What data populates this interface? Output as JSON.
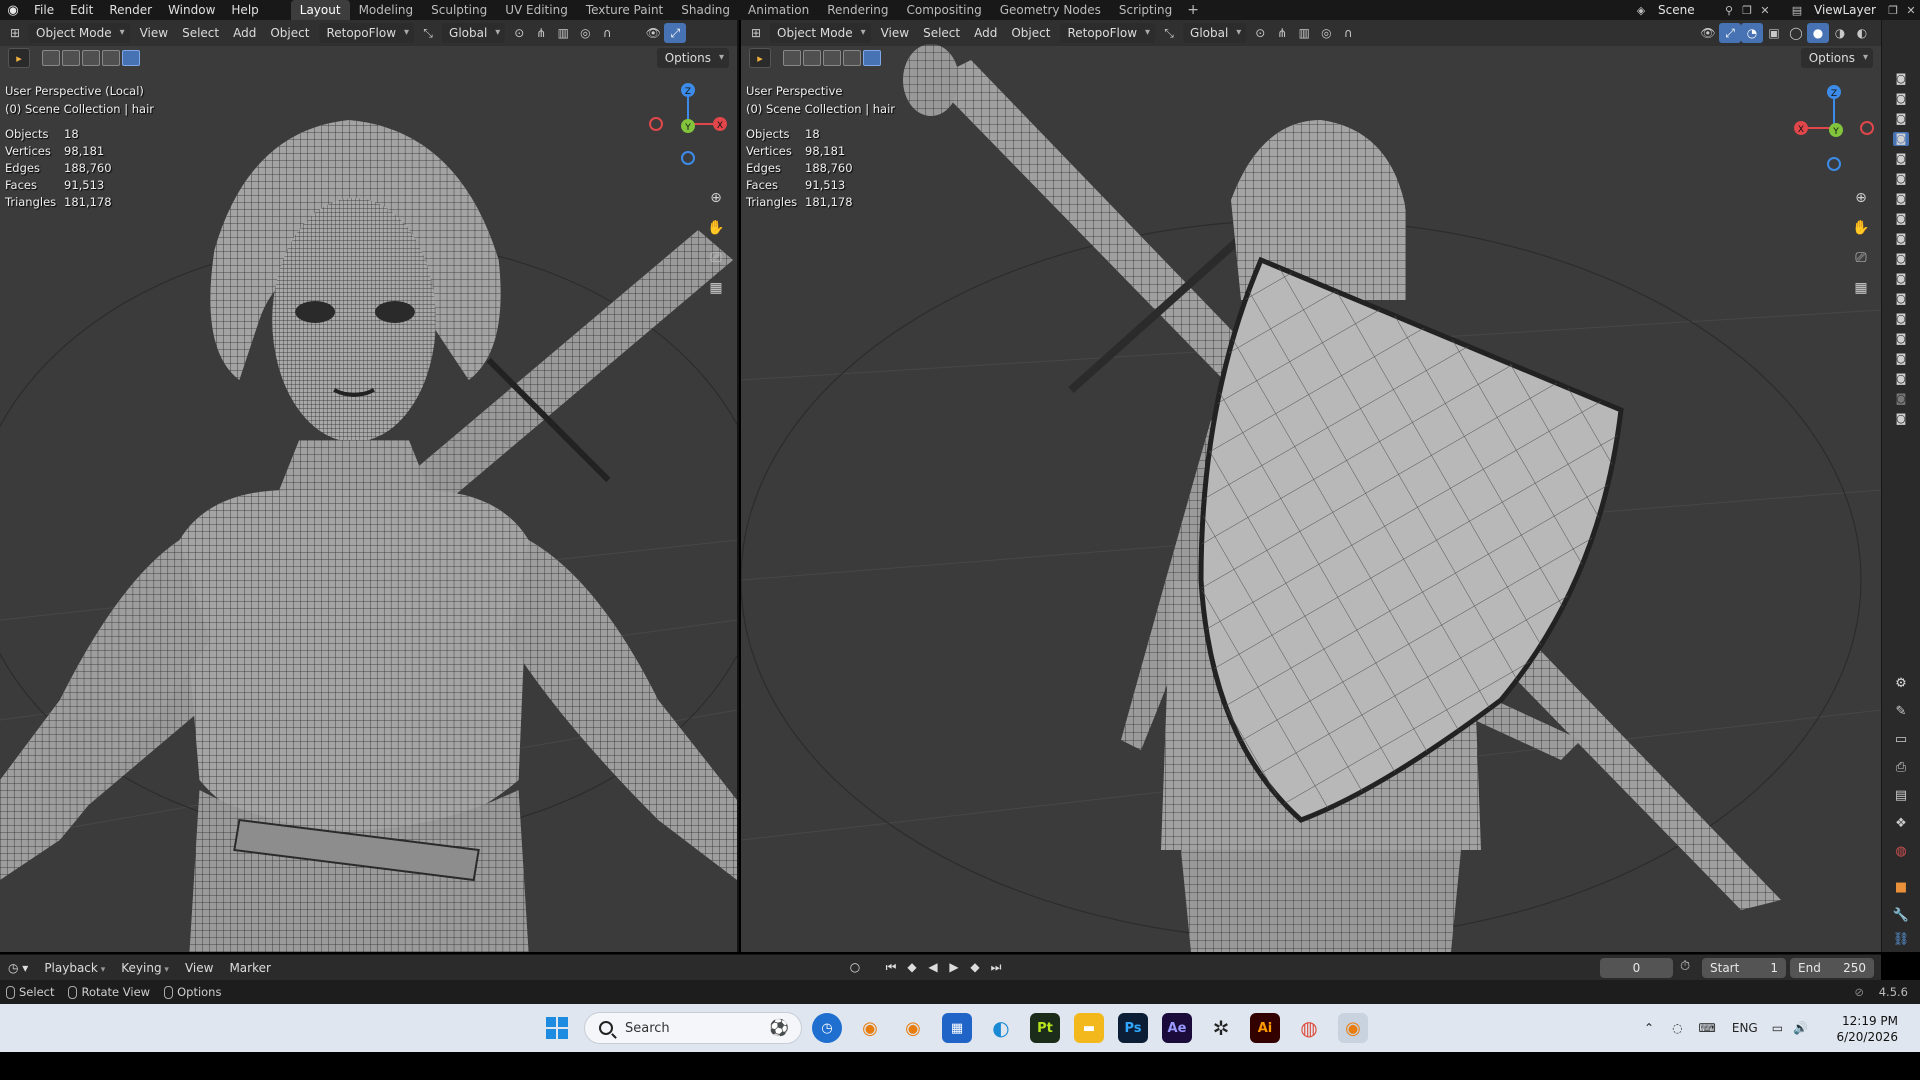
{
  "menubar": {
    "menus": [
      "File",
      "Edit",
      "Render",
      "Window",
      "Help"
    ],
    "workspaces": [
      "Layout",
      "Modeling",
      "Sculpting",
      "UV Editing",
      "Texture Paint",
      "Shading",
      "Animation",
      "Rendering",
      "Compositing",
      "Geometry Nodes",
      "Scripting"
    ],
    "active_workspace": "Layout",
    "add_tab": "+",
    "scene": "Scene",
    "view_layer": "ViewLayer"
  },
  "viewport_header": {
    "mode": "Object Mode",
    "view": "View",
    "select": "Select",
    "add": "Add",
    "object": "Object",
    "addon": "RetopoFlow",
    "transform": "Global",
    "options": "Options"
  },
  "viewport_left": {
    "perspective": "User Perspective (Local)",
    "collection": "(0) Scene Collection | hair"
  },
  "viewport_right": {
    "perspective": "User Perspective",
    "collection": "(0) Scene Collection | hair"
  },
  "stats": {
    "objects_label": "Objects",
    "objects": "18",
    "vertices_label": "Vertices",
    "vertices": "98,181",
    "edges_label": "Edges",
    "edges": "188,760",
    "faces_label": "Faces",
    "faces": "91,513",
    "triangles_label": "Triangles",
    "triangles": "181,178"
  },
  "gizmo": {
    "x": "X",
    "y": "Y",
    "z": "Z"
  },
  "timeline": {
    "playback": "Playback",
    "keying": "Keying",
    "view": "View",
    "marker": "Marker",
    "current_frame": "0",
    "start_label": "Start",
    "start": "1",
    "end_label": "End",
    "end": "250"
  },
  "statusbar": {
    "select": "Select",
    "rotate": "Rotate View",
    "options": "Options",
    "version": "4.5.6"
  },
  "taskbar": {
    "search_placeholder": "Search",
    "language": "ENG",
    "time": "12:19 PM",
    "date": "6/20/2026",
    "pinned": [
      "Ps",
      "Ae",
      "Ai",
      "Pt"
    ]
  },
  "colors": {
    "axis_x": "#e0464a",
    "axis_y": "#82c43b",
    "axis_z": "#3d8be8",
    "accent": "#4772b3",
    "viewport_bg": "#3b3b3b"
  }
}
